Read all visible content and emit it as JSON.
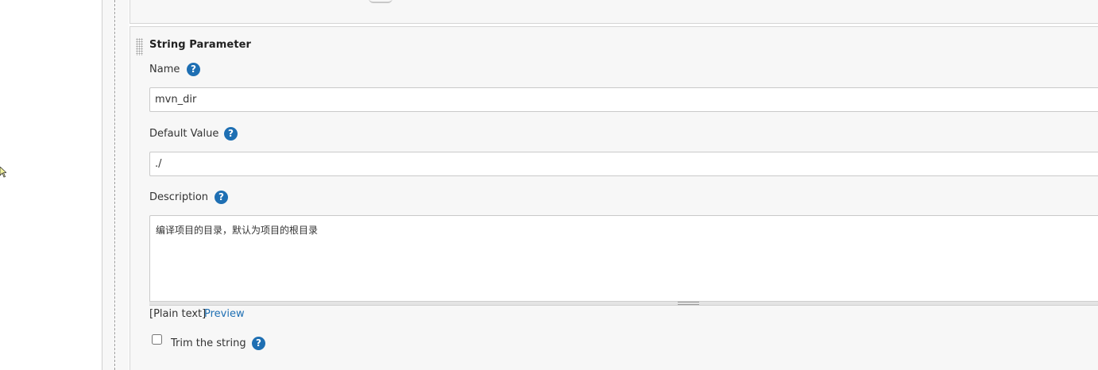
{
  "parameter": {
    "title": "String Parameter",
    "name": {
      "label": "Name",
      "value": "mvn_dir"
    },
    "default_value": {
      "label": "Default Value",
      "value": "./"
    },
    "description": {
      "label": "Description",
      "value": "编译项目的目录，默认为项目的根目录"
    },
    "format_note": "[Plain text]",
    "preview_label": "Preview",
    "trim": {
      "label": "Trim the string",
      "checked": false
    },
    "help_glyph": "?"
  },
  "colors": {
    "accent": "#1e6fb3",
    "panel_background": "#f7f7f7",
    "border": "#c9c9c9"
  },
  "icons": {
    "help": "question-circle-icon",
    "drag": "drag-handle-icon",
    "cursor": "mouse-cursor-icon"
  }
}
